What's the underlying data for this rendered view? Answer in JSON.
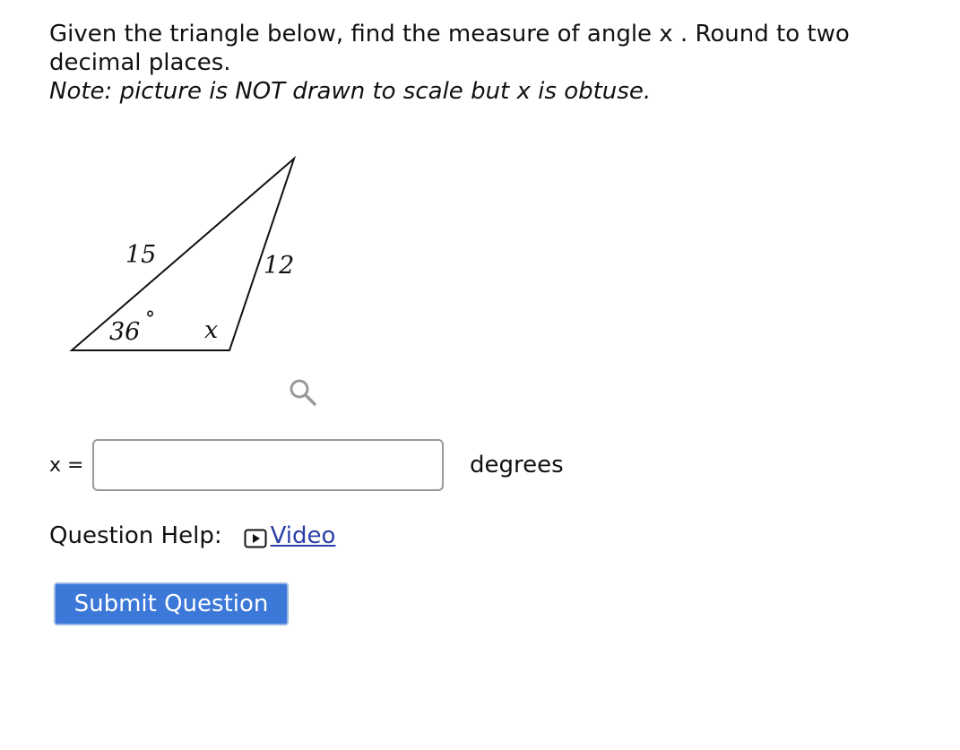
{
  "question": {
    "line1": "Given the triangle below, find the measure of angle x . Round to two",
    "line2": "decimal places.",
    "note": "Note: picture is NOT drawn to scale but x is obtuse."
  },
  "figure": {
    "side_left": "15",
    "side_right": "12",
    "angle_left": "36",
    "angle_left_unit": "°",
    "angle_unknown": "x"
  },
  "icons": {
    "zoom": "magnifier-icon",
    "video": "play-box-icon"
  },
  "answer": {
    "label": "x =",
    "value": "",
    "unit": "degrees"
  },
  "help": {
    "label": "Question Help:",
    "video_label": "Video"
  },
  "submit": {
    "label": "Submit Question"
  },
  "colors": {
    "link": "#2b3fa8",
    "button": "#3b78d8"
  }
}
